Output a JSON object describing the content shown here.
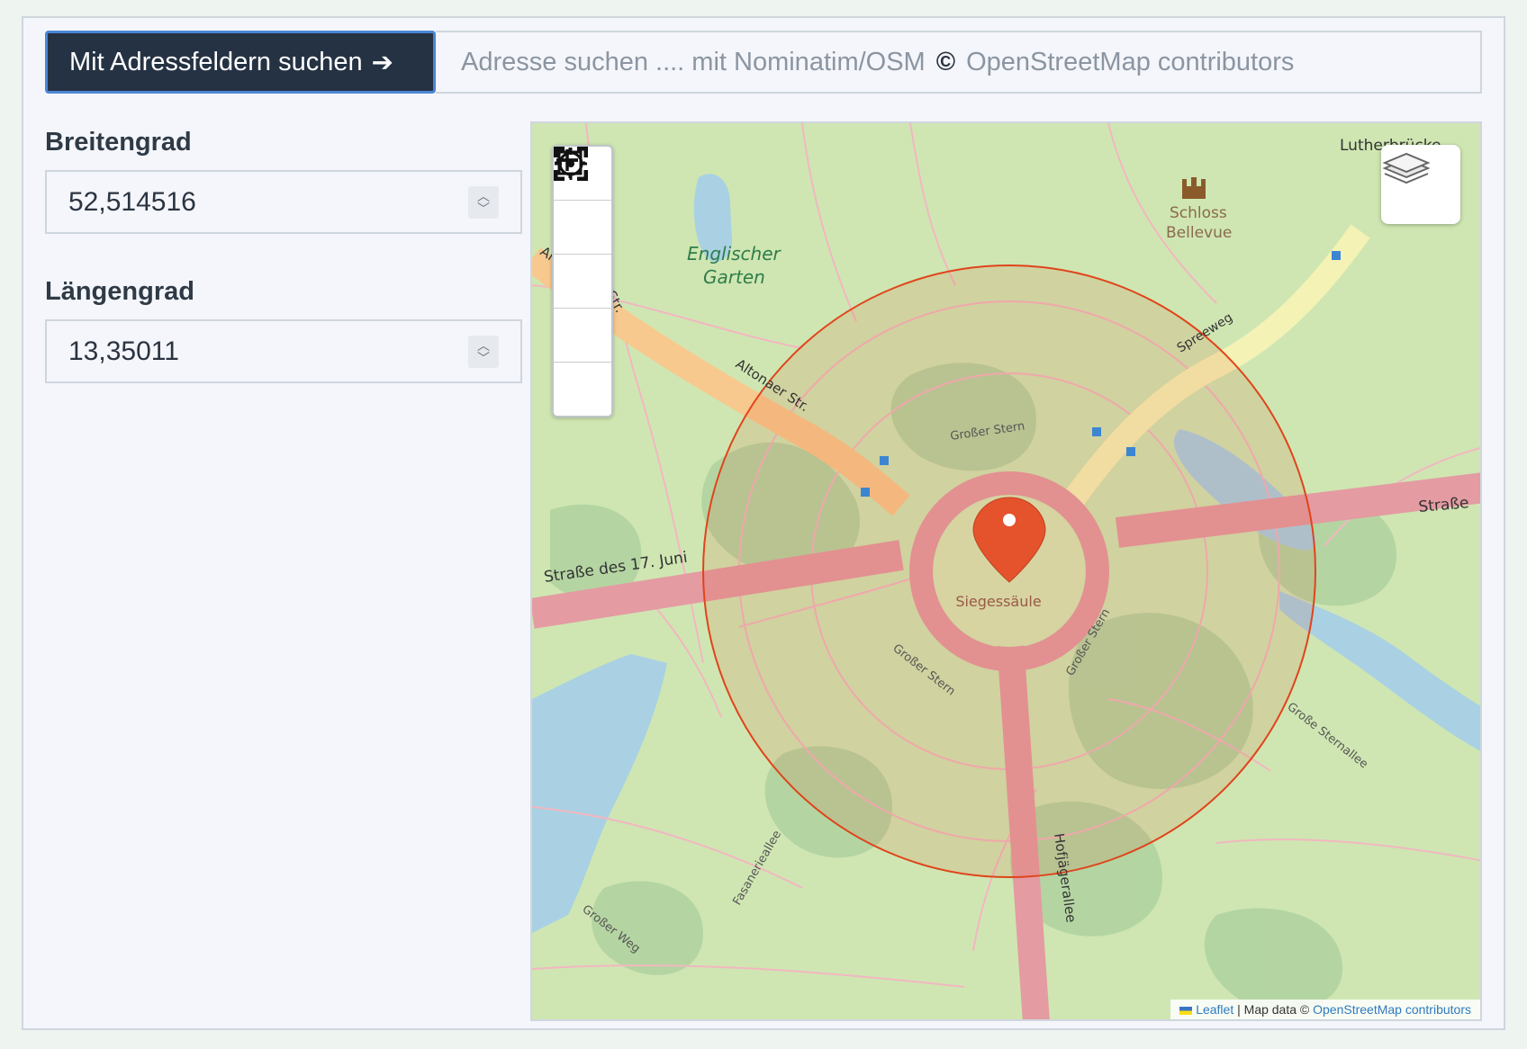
{
  "search": {
    "button_label": "Mit Adressfeldern suchen",
    "button_arrow": "➔",
    "placeholder_prefix": "Adresse suchen .... mit Nominatim/OSM",
    "copyright_symbol": "©",
    "placeholder_suffix": "OpenStreetMap contributors"
  },
  "latitude": {
    "label": "Breitengrad",
    "value": "52,514516"
  },
  "longitude": {
    "label": "Längengrad",
    "value": "13,35011"
  },
  "map": {
    "controls": [
      "fullscreen-icon",
      "zoom-in-icon",
      "zoom-out-icon",
      "fit-bounds-icon",
      "locate-icon"
    ],
    "labels": {
      "siegessaeule": "Siegessäule",
      "grosser_stern_top": "Großer Stern",
      "grosser_stern_left": "Großer Stern",
      "grosser_stern_right": "Großer Stern",
      "altonaer": "Altonaer Str.",
      "altonaer_top": "Al",
      "altonaer_str": "Str.",
      "spreeweg": "Spreeweg",
      "strasse_17_juni": "Straße des 17. Juni",
      "strasse_right": "Straße",
      "englischer": "Englischer",
      "garten": "Garten",
      "schloss": "Schloss",
      "bellevue": "Bellevue",
      "lutherbruecke": "Lutherbrücke",
      "hofjaegerallee": "Hofjägerallee",
      "fasanerieallee": "Fasanerieallee",
      "grosse_sternallee": "Große Sternallee",
      "grosser_weg": "Großer Weg"
    },
    "attribution": {
      "leaflet": "Leaflet",
      "separator": "| Map data ©",
      "osm": "OpenStreetMap contributors"
    },
    "colors": {
      "park": "#cfe6b2",
      "major_road": "#e49ba2",
      "secondary_road": "#f7c98e",
      "tertiary_road": "#f4f2b5",
      "water": "#a9d1e3",
      "circle": "#e0441b",
      "marker": "#e5532c"
    }
  }
}
